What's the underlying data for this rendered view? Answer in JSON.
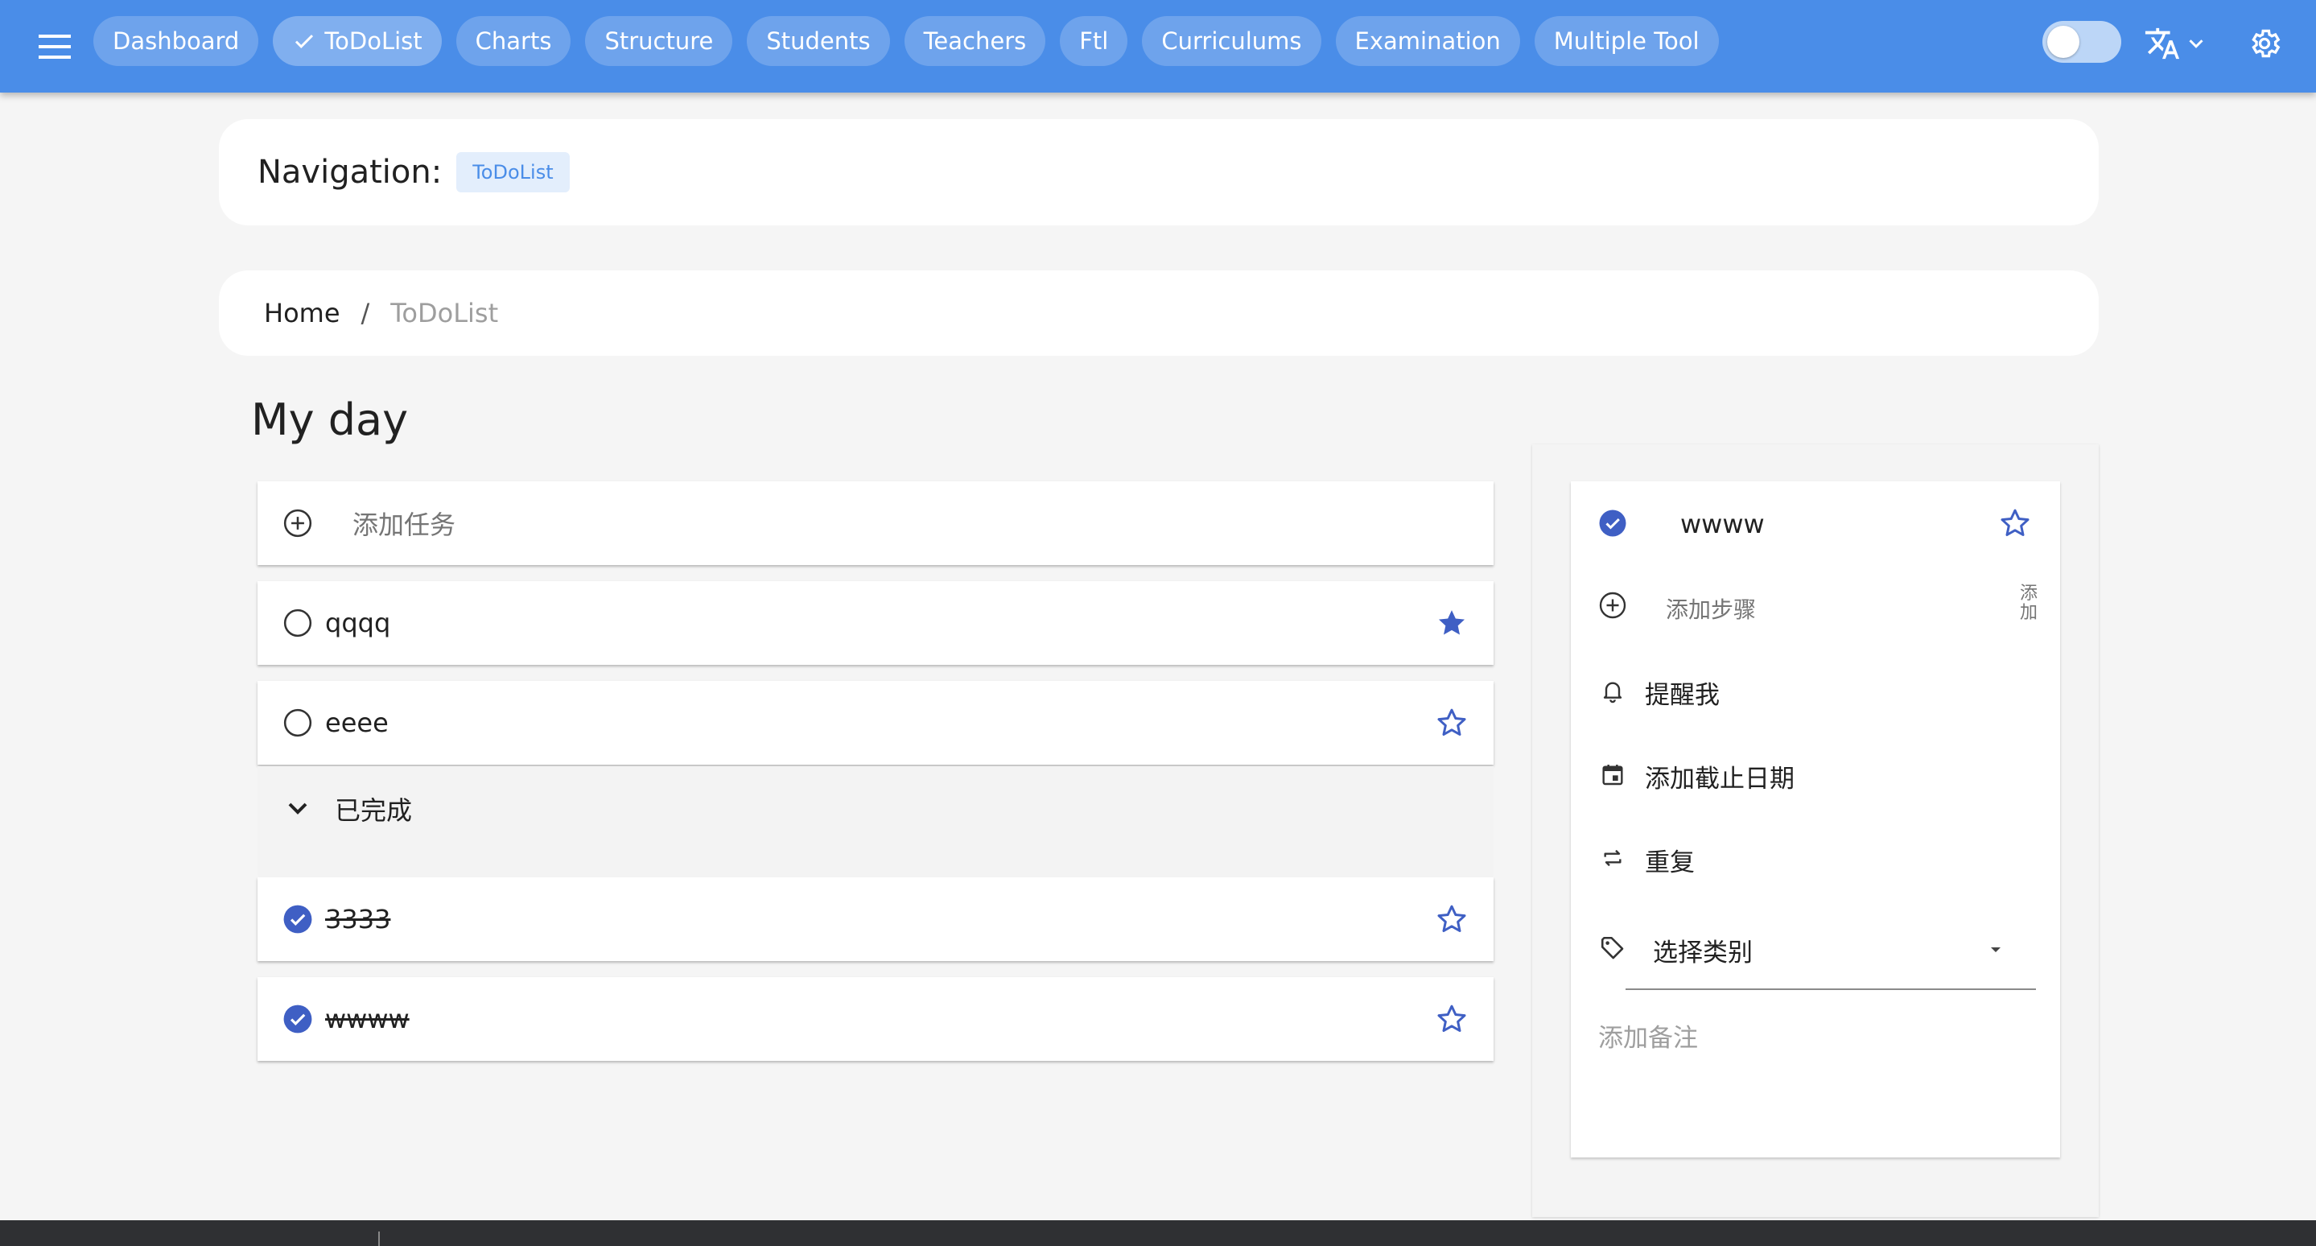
{
  "topbar": {
    "menu_icon": "hamburger-menu-icon",
    "nav": [
      {
        "label": "Dashboard",
        "active": false
      },
      {
        "label": "ToDoList",
        "active": true
      },
      {
        "label": "Charts",
        "active": false
      },
      {
        "label": "Structure",
        "active": false
      },
      {
        "label": "Students",
        "active": false
      },
      {
        "label": "Teachers",
        "active": false
      },
      {
        "label": "Ftl",
        "active": false
      },
      {
        "label": "Curriculums",
        "active": false
      },
      {
        "label": "Examination",
        "active": false
      },
      {
        "label": "Multiple Tool",
        "active": false
      }
    ],
    "toggle_on": false,
    "colors": {
      "bar": "#4a8de8",
      "accent": "#3f5fc4"
    }
  },
  "navigation": {
    "label": "Navigation:",
    "tag": "ToDoList"
  },
  "breadcrumb": {
    "home": "Home",
    "separator": "/",
    "current": "ToDoList"
  },
  "page": {
    "title": "My day"
  },
  "tasks": {
    "add_placeholder": "添加任务",
    "open": [
      {
        "text": "qqqq",
        "starred": true
      },
      {
        "text": "eeee",
        "starred": false
      }
    ],
    "completed_header": "已完成",
    "completed": [
      {
        "text": "3333",
        "starred": false
      },
      {
        "text": "wwww",
        "starred": false
      }
    ]
  },
  "detail": {
    "title": "wwww",
    "add_step": "添加步骤",
    "add_step_button": "添加",
    "remind": "提醒我",
    "due_date": "添加截止日期",
    "repeat": "重复",
    "category_placeholder": "选择类别",
    "note_placeholder": "添加备注"
  }
}
